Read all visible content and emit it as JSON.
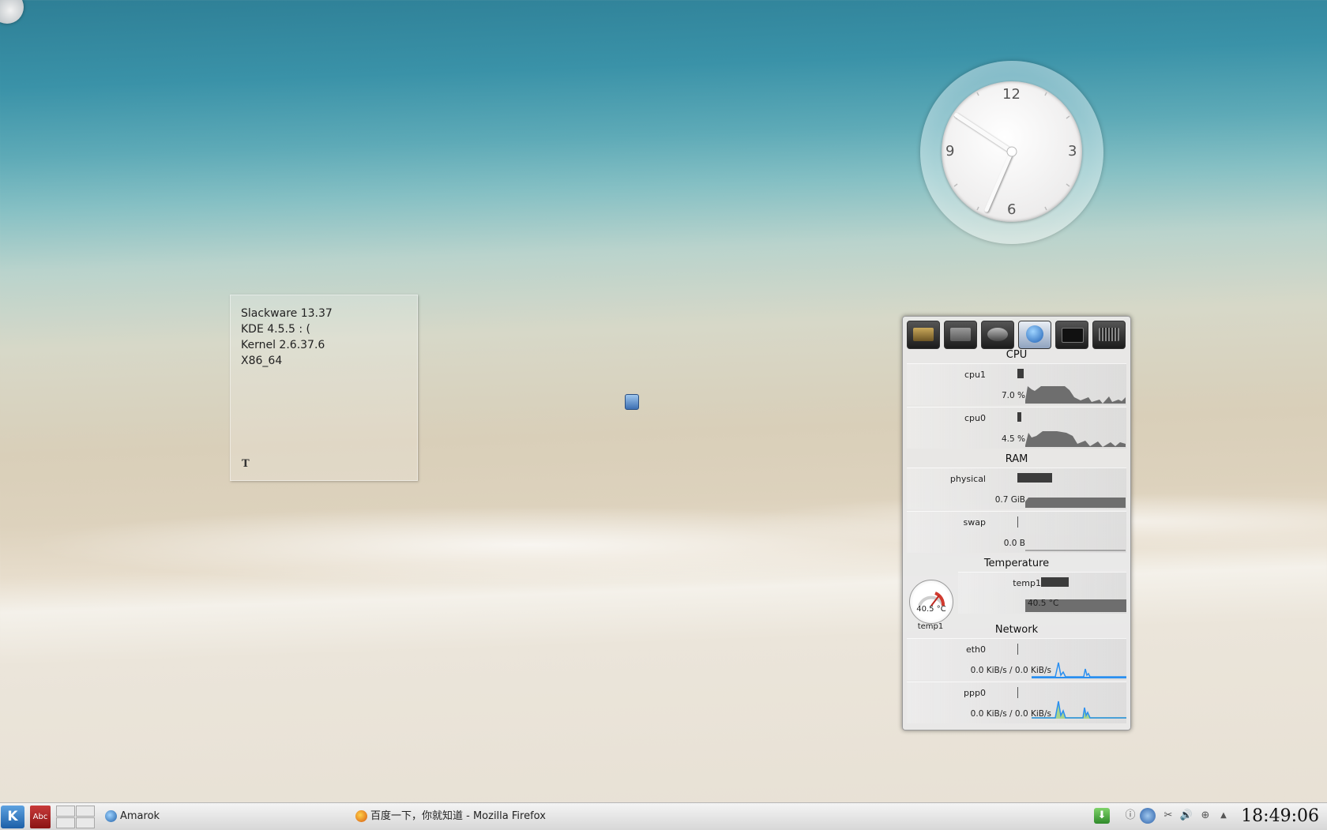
{
  "note": {
    "lines": [
      "Slackware 13.37",
      "KDE 4.5.5 : (",
      "Kernel 2.6.37.6",
      "X86_64"
    ],
    "format_glyph": "T"
  },
  "clock": {
    "numerals": {
      "twelve": "12",
      "three": "3",
      "six": "6",
      "nine": "9"
    },
    "time_shown": "18:49"
  },
  "sysmon": {
    "source_icons": [
      "harddisk-icon",
      "disk-icon",
      "camera-icon",
      "network-globe-icon",
      "terminal-icon",
      "cpu-chip-icon"
    ],
    "sections": {
      "cpu": "CPU",
      "ram": "RAM",
      "temperature": "Temperature",
      "network": "Network"
    },
    "cpu1": {
      "name": "cpu1",
      "value": "7.0 %",
      "load": 0.07
    },
    "cpu0": {
      "name": "cpu0",
      "value": "4.5 %",
      "load": 0.045
    },
    "physical": {
      "name": "physical",
      "value": "0.7 GiB",
      "usage": 0.4
    },
    "swap": {
      "name": "swap",
      "value": "0.0 B",
      "usage": 0
    },
    "temp1": {
      "name": "temp1",
      "value": "40.5 °C"
    },
    "gauge": {
      "value": "40.5 °C",
      "label": "temp1"
    },
    "eth0": {
      "name": "eth0",
      "value": "0.0 KiB/s / 0.0 KiB/s"
    },
    "ppp0": {
      "name": "ppp0",
      "value": "0.0 KiB/s / 0.0 KiB/s"
    },
    "colors": {
      "graph_gray": "#6e6e6e",
      "net_blue": "#2a8ff0",
      "net_green": "#8fcf6a"
    }
  },
  "taskbar": {
    "kde_glyph": "K",
    "dict_label": "Abc",
    "tasks": [
      {
        "label": "Amarok"
      },
      {
        "label": "百度一下，你就知道 - Mozilla Firefox"
      }
    ],
    "time": "18:49:06"
  }
}
